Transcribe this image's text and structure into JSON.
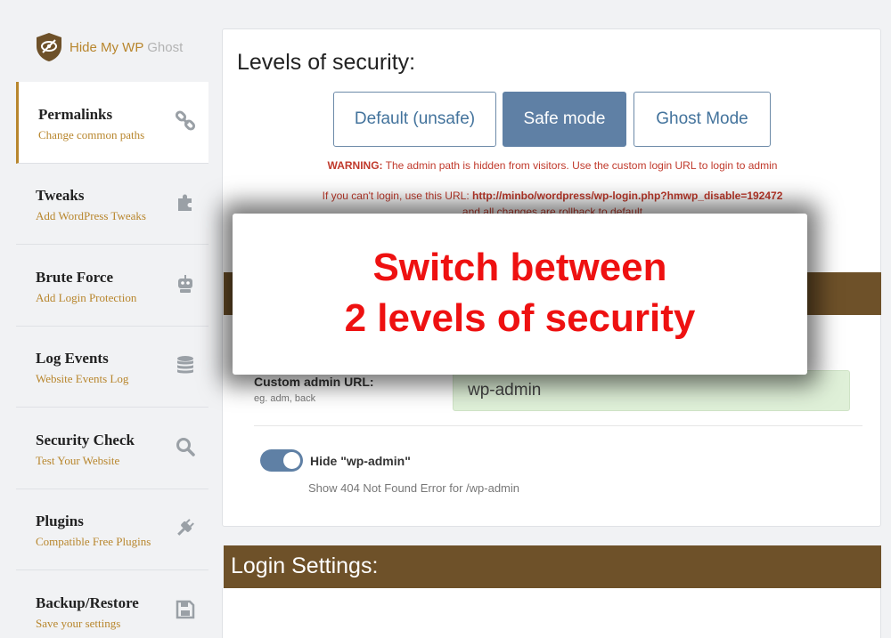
{
  "brand": {
    "name": "Hide My WP",
    "suffix": "Ghost"
  },
  "sidebar": {
    "items": [
      {
        "title": "Permalinks",
        "subtitle": "Change common paths",
        "icon": "link-icon",
        "active": true
      },
      {
        "title": "Tweaks",
        "subtitle": "Add WordPress Tweaks",
        "icon": "puzzle-icon"
      },
      {
        "title": "Brute Force",
        "subtitle": "Add Login Protection",
        "icon": "robot-icon"
      },
      {
        "title": "Log Events",
        "subtitle": "Website Events Log",
        "icon": "database-icon"
      },
      {
        "title": "Security Check",
        "subtitle": "Test Your Website",
        "icon": "search-icon"
      },
      {
        "title": "Plugins",
        "subtitle": "Compatible Free Plugins",
        "icon": "plug-icon"
      },
      {
        "title": "Backup/Restore",
        "subtitle": "Save your settings",
        "icon": "save-icon"
      }
    ]
  },
  "levels": {
    "title": "Levels of security:",
    "buttons": [
      "Default (unsafe)",
      "Safe mode",
      "Ghost Mode"
    ],
    "selected": "Safe mode",
    "warning_label": "WARNING:",
    "warning_text": "The admin path is hidden from visitors. Use the custom login URL to login to admin",
    "login_prefix": "If you can't login, use this URL:",
    "login_url": "http://minbo/wordpress/wp-login.php?hmwp_disable=192472",
    "rollback": "and all changes are rollback to default"
  },
  "admin": {
    "label": "Custom admin URL:",
    "hint": "eg. adm, back",
    "value": "wp-admin",
    "toggle_label": "Hide \"wp-admin\"",
    "toggle_on": true,
    "toggle_desc": "Show 404 Not Found Error for /wp-admin"
  },
  "login_settings": {
    "title": "Login Settings:"
  },
  "overlay": {
    "line1": "Switch between",
    "line2": "2 levels of security"
  },
  "colors": {
    "accent": "#b8862d",
    "band": "#6e5129",
    "primary": "#5f80a5",
    "overlay_text": "#ee1111"
  }
}
